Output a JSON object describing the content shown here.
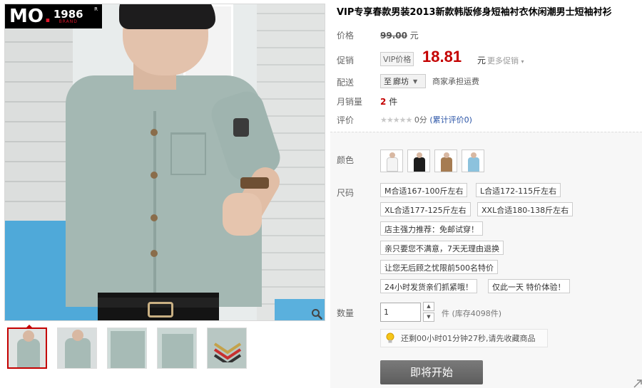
{
  "brand": {
    "mo": "MO",
    "year": "1986",
    "brand_word": "BRAND",
    "reg": "R"
  },
  "product": {
    "title": "VIP专享春款男装2013新款韩版修身短袖衬衣休闲潮男士短袖衬衫"
  },
  "labels": {
    "price": "价格",
    "promo": "促销",
    "shipping": "配送",
    "monthly_sales": "月销量",
    "rating": "评价",
    "color": "颜色",
    "size": "尺码",
    "quantity": "数量"
  },
  "price": {
    "original": "99.00",
    "unit": "元"
  },
  "promo": {
    "tag": "VIP价格",
    "price": "18.81",
    "unit": "元",
    "more": "更多促销"
  },
  "shipping": {
    "prefix": "至",
    "city": "廊坊",
    "note": "商家承担运费"
  },
  "sales": {
    "count": "2",
    "unit": "件"
  },
  "rating": {
    "stars": "★★★★★",
    "score": "0分",
    "link": "(累计评价0)"
  },
  "colors": [
    {
      "name": "white",
      "color": "#f4f4f4"
    },
    {
      "name": "black",
      "color": "#1d1d1d"
    },
    {
      "name": "khaki",
      "color": "#a67c52"
    },
    {
      "name": "light-blue",
      "color": "#8cc2dd"
    }
  ],
  "sizes": [
    "M合适167-100斤左右",
    "L合适172-115斤左右",
    "XL合适177-125斤左右",
    "XXL合适180-138斤左右",
    "店主强力推荐：免邮试穿！",
    "亲只要您不满意，7天无理由退换",
    "让您无后顾之忧限前500名特价",
    "24小时发货亲们抓紧哦！",
    "仅此一天 特价体验！"
  ],
  "quantity": {
    "value": "1",
    "unit": "件",
    "stock": "(库存4098件)"
  },
  "notice": {
    "text": "还剩00小时01分钟27秒,请先收藏商品"
  },
  "action": {
    "start_label": "即将开始"
  },
  "icons": {
    "zoom": "magnifier-icon",
    "bulb": "lightbulb-icon",
    "arrow": "chevron-down-icon"
  },
  "accent": {
    "price_red": "#c40000",
    "link_blue": "#2953a6"
  }
}
